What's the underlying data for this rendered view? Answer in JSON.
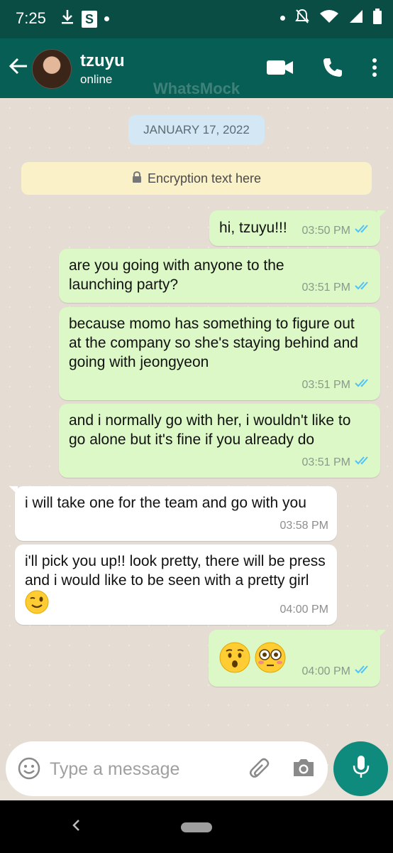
{
  "status": {
    "time": "7:25",
    "s_badge": "S"
  },
  "contact": {
    "name": "tzuyu",
    "status": "online"
  },
  "watermark": "WhatsMock",
  "date_chip": "JANUARY 17, 2022",
  "encryption_text": "Encryption text here",
  "messages": [
    {
      "direction": "out",
      "text": "hi, tzuyu!!!",
      "time": "03:50 PM",
      "read": true
    },
    {
      "direction": "out",
      "text": "are you going with anyone to the launching party?",
      "time": "03:51 PM",
      "read": true
    },
    {
      "direction": "out",
      "text": "because momo has something to figure out at the company so she's staying behind and going with jeongyeon",
      "time": "03:51 PM",
      "read": true
    },
    {
      "direction": "out",
      "text": "and i normally go with her, i wouldn't like to go alone but it's fine if you already do",
      "time": "03:51 PM",
      "read": true
    },
    {
      "direction": "in",
      "text": "i will take one for the team and go with you",
      "time": "03:58 PM"
    },
    {
      "direction": "in",
      "text": "i'll pick you up!! look pretty, there will be press and i would like to be seen with a pretty girl",
      "emoji": "winking-face",
      "time": "04:00 PM"
    },
    {
      "direction": "out",
      "text": "",
      "emoji": [
        "hushed-face",
        "flushed-face"
      ],
      "time": "04:00 PM",
      "read": true
    }
  ],
  "input": {
    "placeholder": "Type a message"
  },
  "colors": {
    "header": "#075e54",
    "status_bar": "#0a4d45",
    "outgoing_bubble": "#dcf8c6",
    "incoming_bubble": "#ffffff",
    "read_ticks": "#4fc3f7",
    "mic_button": "#0f8b7e"
  },
  "icons": [
    "back-arrow-icon",
    "video-call-icon",
    "phone-icon",
    "more-vert-icon",
    "lock-icon",
    "double-check-icon",
    "smiley-icon",
    "attach-icon",
    "camera-icon",
    "mic-icon"
  ]
}
